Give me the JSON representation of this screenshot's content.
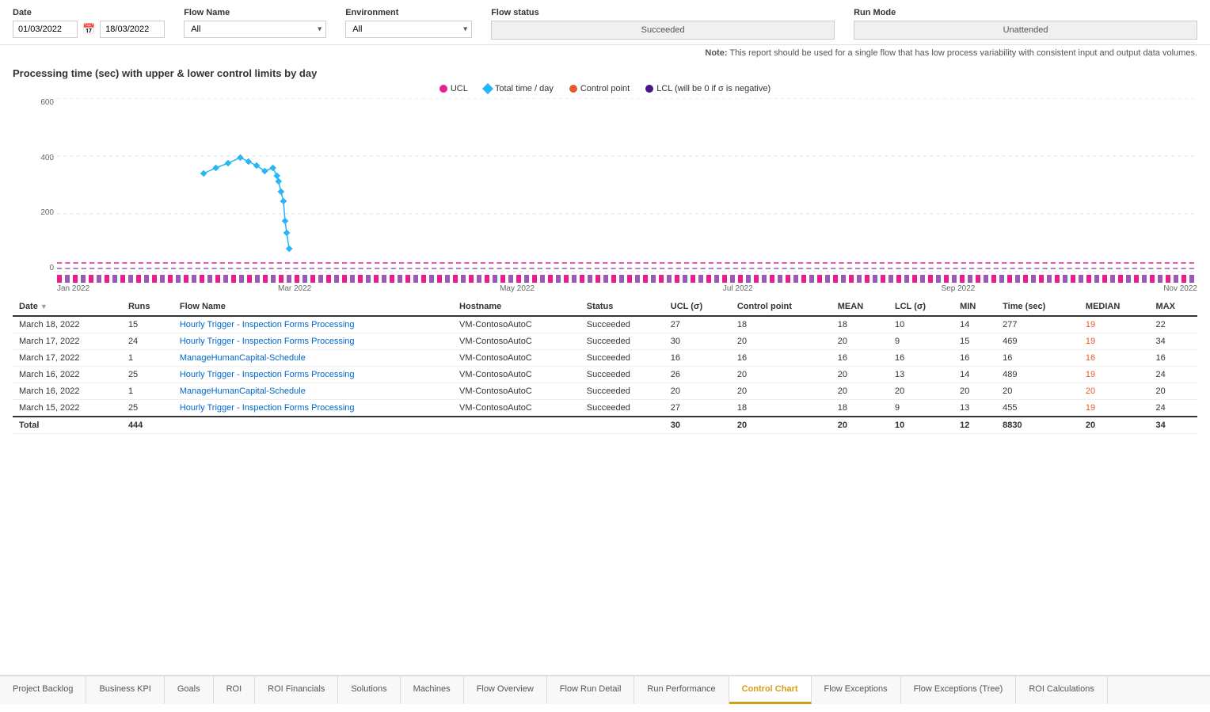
{
  "filters": {
    "date_label": "Date",
    "date_from": "01/03/2022",
    "date_to": "18/03/2022",
    "flow_name_label": "Flow Name",
    "flow_name_value": "All",
    "environment_label": "Environment",
    "environment_value": "All",
    "flow_status_label": "Flow status",
    "flow_status_value": "Succeeded",
    "run_mode_label": "Run Mode",
    "run_mode_value": "Unattended"
  },
  "note": "Note:",
  "note_text": "This report should be used for a single flow that has low process variability with consistent input and output data volumes.",
  "chart": {
    "title": "Processing time (sec) with upper & lower control limits by day",
    "legend": [
      {
        "label": "UCL",
        "color": "#e91e8c",
        "shape": "circle"
      },
      {
        "label": "Total time / day",
        "color": "#29b6f6",
        "shape": "diamond"
      },
      {
        "label": "Control point",
        "color": "#e85a2a",
        "shape": "circle"
      },
      {
        "label": "LCL (will be 0 if σ is negative)",
        "color": "#4a148c",
        "shape": "circle"
      }
    ],
    "y_labels": [
      "600",
      "400",
      "200",
      "0"
    ],
    "x_labels": [
      "Jan 2022",
      "Mar 2022",
      "May 2022",
      "Jul 2022",
      "Sep 2022",
      "Nov 2022"
    ]
  },
  "table": {
    "columns": [
      {
        "key": "date",
        "label": "Date",
        "sortable": true
      },
      {
        "key": "runs",
        "label": "Runs",
        "sortable": false
      },
      {
        "key": "flow_name",
        "label": "Flow Name",
        "sortable": false
      },
      {
        "key": "hostname",
        "label": "Hostname",
        "sortable": false
      },
      {
        "key": "status",
        "label": "Status",
        "sortable": false
      },
      {
        "key": "ucl",
        "label": "UCL (σ)",
        "sortable": false
      },
      {
        "key": "control_point",
        "label": "Control point",
        "sortable": false
      },
      {
        "key": "mean",
        "label": "MEAN",
        "sortable": false
      },
      {
        "key": "lcl",
        "label": "LCL (σ)",
        "sortable": false
      },
      {
        "key": "min",
        "label": "MIN",
        "sortable": false
      },
      {
        "key": "time_sec",
        "label": "Time (sec)",
        "sortable": false
      },
      {
        "key": "median",
        "label": "MEDIAN",
        "sortable": false
      },
      {
        "key": "max",
        "label": "MAX",
        "sortable": false
      }
    ],
    "rows": [
      {
        "date": "March 18, 2022",
        "runs": "15",
        "flow_name": "Hourly Trigger - Inspection Forms Processing",
        "hostname": "VM-ContosoAutoC",
        "status": "Succeeded",
        "ucl": "27",
        "control_point": "18",
        "mean": "18",
        "lcl": "10",
        "min": "14",
        "time_sec": "277",
        "median": "19",
        "max": "22"
      },
      {
        "date": "March 17, 2022",
        "runs": "24",
        "flow_name": "Hourly Trigger - Inspection Forms Processing",
        "hostname": "VM-ContosoAutoC",
        "status": "Succeeded",
        "ucl": "30",
        "control_point": "20",
        "mean": "20",
        "lcl": "9",
        "min": "15",
        "time_sec": "469",
        "median": "19",
        "max": "34"
      },
      {
        "date": "March 17, 2022",
        "runs": "1",
        "flow_name": "ManageHumanCapital-Schedule",
        "hostname": "VM-ContosoAutoC",
        "status": "Succeeded",
        "ucl": "16",
        "control_point": "16",
        "mean": "16",
        "lcl": "16",
        "min": "16",
        "time_sec": "16",
        "median": "16",
        "max": "16"
      },
      {
        "date": "March 16, 2022",
        "runs": "25",
        "flow_name": "Hourly Trigger - Inspection Forms Processing",
        "hostname": "VM-ContosoAutoC",
        "status": "Succeeded",
        "ucl": "26",
        "control_point": "20",
        "mean": "20",
        "lcl": "13",
        "min": "14",
        "time_sec": "489",
        "median": "19",
        "max": "24"
      },
      {
        "date": "March 16, 2022",
        "runs": "1",
        "flow_name": "ManageHumanCapital-Schedule",
        "hostname": "VM-ContosoAutoC",
        "status": "Succeeded",
        "ucl": "20",
        "control_point": "20",
        "mean": "20",
        "lcl": "20",
        "min": "20",
        "time_sec": "20",
        "median": "20",
        "max": "20"
      },
      {
        "date": "March 15, 2022",
        "runs": "25",
        "flow_name": "Hourly Trigger - Inspection Forms Processing",
        "hostname": "VM-ContosoAutoC",
        "status": "Succeeded",
        "ucl": "27",
        "control_point": "18",
        "mean": "18",
        "lcl": "9",
        "min": "13",
        "time_sec": "455",
        "median": "19",
        "max": "24"
      }
    ],
    "total": {
      "label": "Total",
      "runs": "444",
      "ucl": "30",
      "control_point": "20",
      "mean": "20",
      "lcl": "10",
      "min": "12",
      "time_sec": "8830",
      "median": "20",
      "max": "34"
    }
  },
  "tabs": [
    {
      "id": "project-backlog",
      "label": "Project Backlog"
    },
    {
      "id": "business-kpi",
      "label": "Business KPI"
    },
    {
      "id": "goals",
      "label": "Goals"
    },
    {
      "id": "roi",
      "label": "ROI"
    },
    {
      "id": "roi-financials",
      "label": "ROI Financials"
    },
    {
      "id": "solutions",
      "label": "Solutions"
    },
    {
      "id": "machines",
      "label": "Machines"
    },
    {
      "id": "flow-overview",
      "label": "Flow Overview"
    },
    {
      "id": "flow-run-detail",
      "label": "Flow Run Detail"
    },
    {
      "id": "run-performance",
      "label": "Run Performance"
    },
    {
      "id": "control-chart",
      "label": "Control Chart",
      "active": true
    },
    {
      "id": "flow-exceptions",
      "label": "Flow Exceptions"
    },
    {
      "id": "flow-exceptions-tree",
      "label": "Flow Exceptions (Tree)"
    },
    {
      "id": "roi-calculations",
      "label": "ROI Calculations"
    }
  ]
}
